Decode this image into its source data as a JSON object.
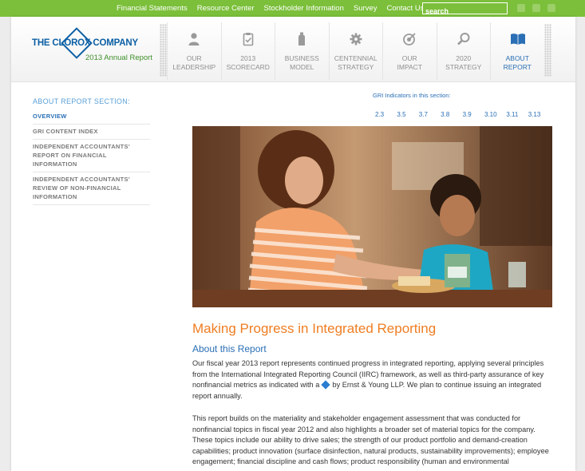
{
  "top_nav": {
    "links": [
      "Financial Statements",
      "Resource Center",
      "Stockholder Information",
      "Survey",
      "Contact Us"
    ],
    "search_placeholder": "search"
  },
  "logo": {
    "company": "THE CLOROX COMPANY",
    "subtitle": "2013 Annual Report"
  },
  "main_nav": [
    {
      "line1": "OUR",
      "line2": "LEADERSHIP",
      "icon": "person-icon"
    },
    {
      "line1": "2013",
      "line2": "SCORECARD",
      "icon": "clipboard-icon"
    },
    {
      "line1": "BUSINESS",
      "line2": "MODEL",
      "icon": "bottle-icon"
    },
    {
      "line1": "CENTENNIAL",
      "line2": "STRATEGY",
      "icon": "gear-icon"
    },
    {
      "line1": "OUR",
      "line2": "IMPACT",
      "icon": "target-icon"
    },
    {
      "line1": "2020",
      "line2": "STRATEGY",
      "icon": "magnifier-icon"
    },
    {
      "line1": "ABOUT",
      "line2": "REPORT",
      "icon": "book-icon"
    }
  ],
  "sidebar": {
    "title": "ABOUT REPORT SECTION:",
    "items": [
      {
        "l1": "OVERVIEW",
        "l2": "",
        "l3": ""
      },
      {
        "l1": "GRI CONTENT INDEX",
        "l2": "",
        "l3": ""
      },
      {
        "l1": "INDEPENDENT ACCOUNTANTS'",
        "l2": "REPORT ON FINANCIAL",
        "l3": "INFORMATION"
      },
      {
        "l1": "INDEPENDENT ACCOUNTANTS'",
        "l2": "REVIEW OF NON-FINANCIAL",
        "l3": "INFORMATION"
      }
    ]
  },
  "gri": {
    "title": "GRI Indicators in this section:",
    "links": [
      "2.3",
      "3.5",
      "3.7",
      "3.8",
      "3.9",
      "3.10",
      "3.11",
      "3.13"
    ]
  },
  "article": {
    "title": "Making Progress in Integrated Reporting",
    "subtitle": "About this Report",
    "p1a": "Our fiscal year 2013 report represents continued progress in integrated reporting, applying several principles from the International Integrated Reporting Council (IIRC) framework, as well as third-party assurance of key nonfinancial metrics as indicated with a",
    "p1b": "by Ernst & Young LLP. We plan to continue issuing an integrated report annually.",
    "p2": "This report builds on the materiality and stakeholder engagement assessment that was conducted for nonfinancial topics in fiscal year 2012 and also highlights a broader set of material topics for the company. These topics include our ability to drive sales; the strength of our product portfolio and demand-creation capabilities; product innovation (surface disinfection, natural products, sustainability improvements); employee engagement; financial discipline and cash flows; product responsibility (human and environmental"
  },
  "colors": {
    "topbar": "#7bbf3a",
    "link_blue": "#2a6fb5",
    "title_orange": "#ef7d22"
  }
}
